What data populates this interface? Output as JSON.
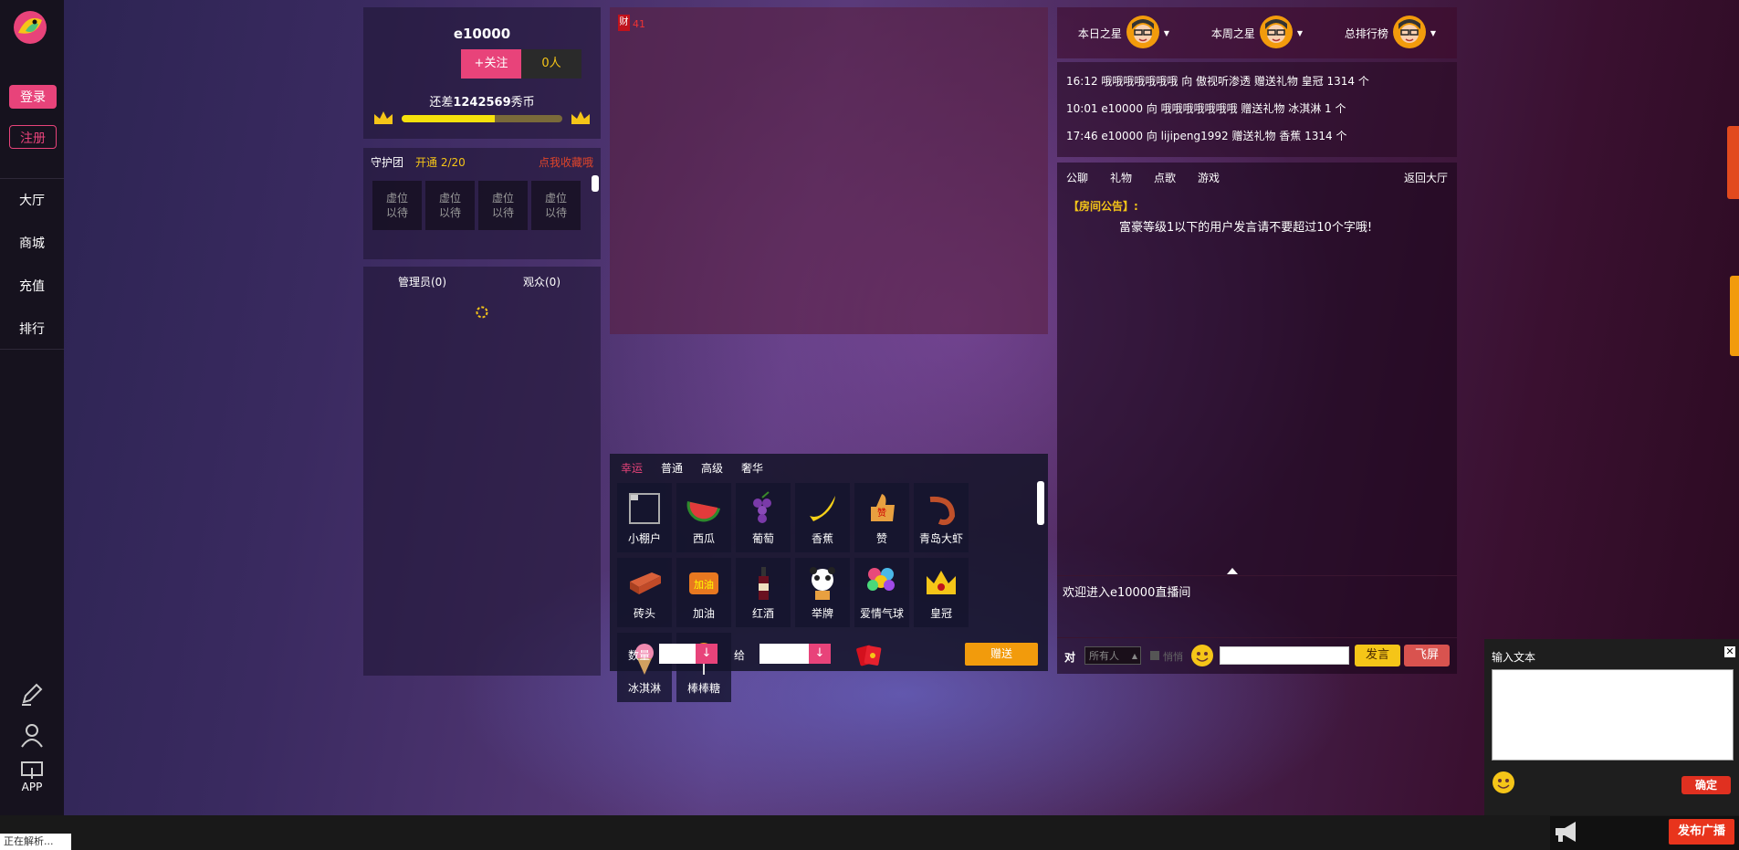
{
  "sidebar": {
    "login": "登录",
    "register": "注册",
    "nav": [
      "大厅",
      "商城",
      "充值",
      "排行"
    ],
    "app_label": "APP"
  },
  "host": {
    "name": "e10000",
    "follow": "+关注",
    "followers": "0人",
    "progress_prefix": "还差",
    "progress_amount": "1242569",
    "progress_suffix": "秀币",
    "progress_fraction": 0.58
  },
  "guard": {
    "title": "守护团",
    "open": "开通 2/20",
    "collect": "点我收藏哦",
    "slot_label": "虚位以待",
    "slots": 4
  },
  "members": {
    "admins": "管理员(0)",
    "audience": "观众(0)"
  },
  "video": {
    "badge": "财",
    "count": "41"
  },
  "gift_tabs": [
    "幸运",
    "普通",
    "高级",
    "奢华"
  ],
  "gifts": [
    {
      "name": "小棚户",
      "icon": "broken-image-icon"
    },
    {
      "name": "西瓜",
      "icon": "watermelon-icon"
    },
    {
      "name": "葡萄",
      "icon": "grape-icon"
    },
    {
      "name": "香蕉",
      "icon": "banana-icon"
    },
    {
      "name": "赞",
      "icon": "thumbs-up-icon"
    },
    {
      "name": "青岛大虾",
      "icon": "shrimp-icon"
    },
    {
      "name": "砖头",
      "icon": "brick-icon"
    },
    {
      "name": "加油",
      "icon": "cheer-icon"
    },
    {
      "name": "红酒",
      "icon": "wine-icon"
    },
    {
      "name": "举牌",
      "icon": "panda-sign-icon"
    },
    {
      "name": "爱情气球",
      "icon": "balloons-icon"
    },
    {
      "name": "皇冠",
      "icon": "crown-icon"
    },
    {
      "name": "冰淇淋",
      "icon": "ice-cream-icon"
    },
    {
      "name": "棒棒糖",
      "icon": "lollipop-icon"
    }
  ],
  "gift_bar": {
    "qty_label": "数量",
    "to_label": "给",
    "send": "赠送"
  },
  "ranks": [
    "本日之星",
    "本周之星",
    "总排行榜"
  ],
  "feed": [
    "16:12 哦哦哦哦哦哦哦 向 傲视听渗透 赠送礼物 皇冠 1314 个",
    "10:01 e10000 向 哦哦哦哦哦哦哦 赠送礼物 冰淇淋 1 个",
    "17:46 e10000 向 lijipeng1992 赠送礼物 香蕉 1314 个"
  ],
  "chat_tabs": [
    "公聊",
    "礼物",
    "点歌",
    "游戏"
  ],
  "back_hall": "返回大厅",
  "announcement_label": "【房间公告】:",
  "announcement": "富豪等级1以下的用户发言请不要超过10个字哦!",
  "welcome": "欢迎进入e10000直播间",
  "chat_bar": {
    "to": "对",
    "target": "所有人",
    "whisper": "悄悄",
    "speak": "发言",
    "fly": "飞屏"
  },
  "text_popup": {
    "title": "输入文本",
    "confirm": "确定"
  },
  "broadcast": "发布广播",
  "status": "正在解析...",
  "colors": {
    "pink": "#e8437a",
    "gold": "#f5c518",
    "orange": "#f29b0c",
    "red": "#e03020"
  }
}
